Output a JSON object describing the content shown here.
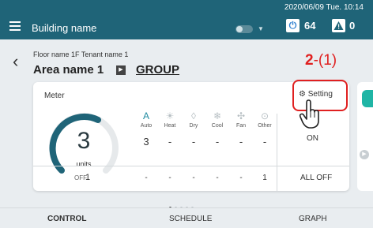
{
  "topbar": {
    "building": "Building name",
    "datetime": "2020/06/09 Tue. 10:14",
    "power_count": "64",
    "alert_count": "0",
    "colors": {
      "bar": "#1f6478"
    }
  },
  "header": {
    "floor_tenant": "Floor name 1F Tenant name 1",
    "area": "Area name 1",
    "group": "GROUP"
  },
  "annotation": {
    "step": "2",
    "sub": "-(1)"
  },
  "card": {
    "meter_label": "Meter",
    "setting_label": "Setting",
    "gauge_value": "3",
    "gauge_unit": "units",
    "off_label": "OFF",
    "off_count": "1",
    "on_label": "ON",
    "all_off_label": "ALL OFF",
    "modes": [
      {
        "label": "Auto",
        "icon": "auto-icon",
        "glyph": "A",
        "count_on": "3",
        "count_off": "-"
      },
      {
        "label": "Heat",
        "icon": "heat-icon",
        "glyph": "☀",
        "count_on": "-",
        "count_off": "-"
      },
      {
        "label": "Dry",
        "icon": "dry-icon",
        "glyph": "◊",
        "count_on": "-",
        "count_off": "-"
      },
      {
        "label": "Cool",
        "icon": "cool-icon",
        "glyph": "❄",
        "count_on": "-",
        "count_off": "-"
      },
      {
        "label": "Fan",
        "icon": "fan-icon",
        "glyph": "✣",
        "count_on": "-",
        "count_off": "-"
      },
      {
        "label": "Other",
        "icon": "other-icon",
        "glyph": "⊙",
        "count_on": "-",
        "count_off": "1"
      }
    ]
  },
  "tabs": {
    "control": "CONTROL",
    "schedule": "SCHEDULE",
    "graph": "GRAPH"
  }
}
